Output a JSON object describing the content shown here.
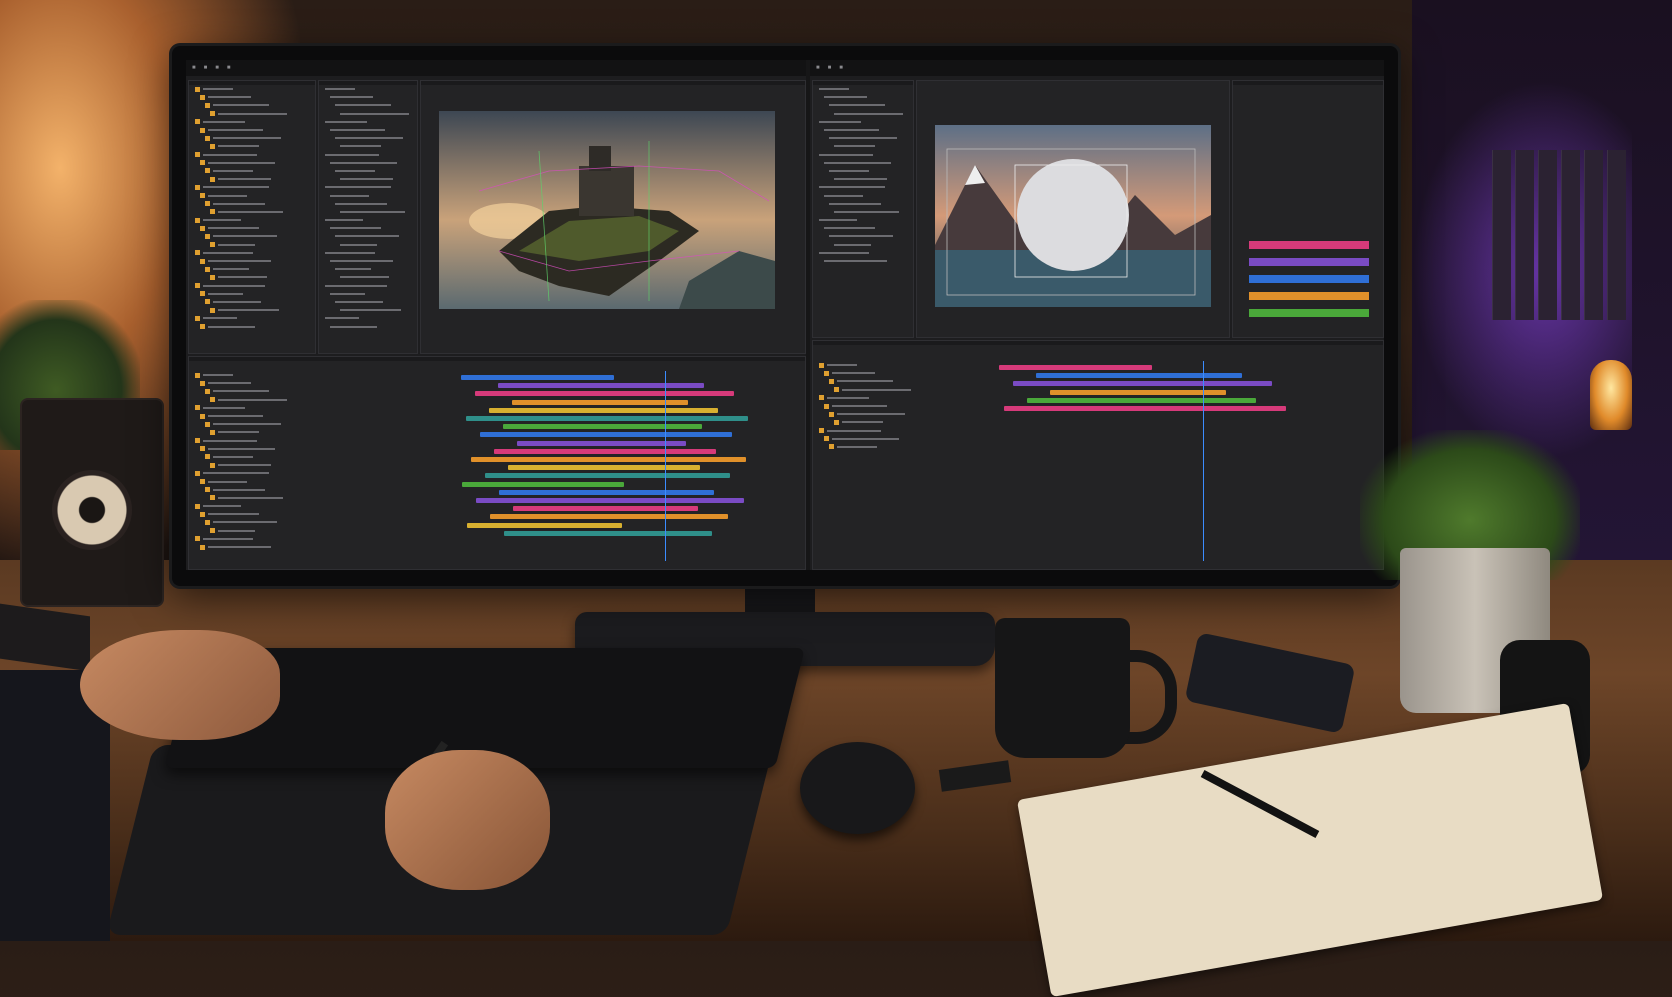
{
  "scene": {
    "description_free": true
  },
  "screen": {
    "left_app": {
      "menu_items": [
        "",
        "",
        "",
        "",
        "",
        ""
      ],
      "layers_panel_title": "",
      "project_panel_title": "",
      "viewer_title": "",
      "timeline_title": ""
    },
    "right_app": {
      "menu_items": [
        "",
        "",
        "",
        "",
        ""
      ],
      "effects_panel_title": "",
      "properties_panel_title": "",
      "timeline_title": ""
    },
    "colors": {
      "accent_blue": "#3b8cff",
      "track_blue": "#2f6fd6",
      "track_purple": "#7a4bc4",
      "track_pink": "#d63a7a",
      "track_orange": "#e0902a",
      "track_green": "#4aa83a",
      "track_teal": "#2f8f8a",
      "track_yellow": "#d8b030",
      "folder_yellow": "#e0a030"
    }
  }
}
